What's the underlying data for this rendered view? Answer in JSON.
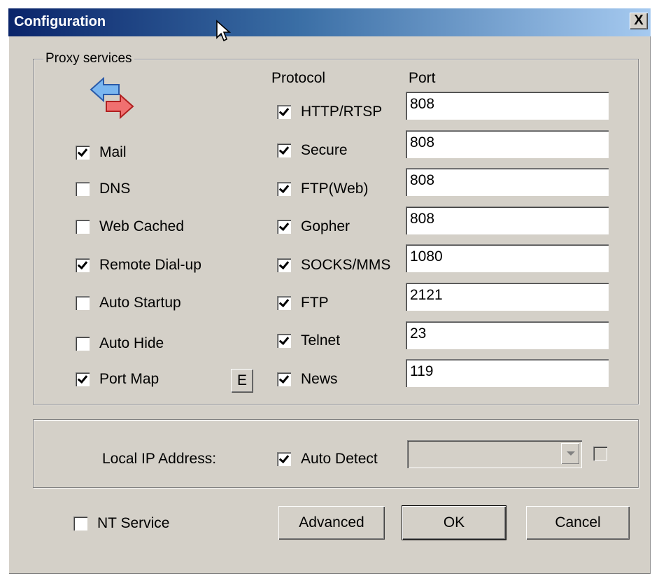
{
  "window": {
    "title": "Configuration",
    "close_label": "X"
  },
  "proxy": {
    "group_label": "Proxy services",
    "services": [
      {
        "label": "Mail",
        "checked": true
      },
      {
        "label": "DNS",
        "checked": false
      },
      {
        "label": "Web Cached",
        "checked": false
      },
      {
        "label": "Remote Dial-up",
        "checked": true
      },
      {
        "label": "Auto Startup",
        "checked": false
      },
      {
        "label": "Auto Hide",
        "checked": false
      },
      {
        "label": "Port Map",
        "checked": true
      }
    ],
    "portmap_edit_label": "E",
    "protocol_header": "Protocol",
    "port_header": "Port",
    "protocols": [
      {
        "label": "HTTP/RTSP",
        "checked": true,
        "port": "808"
      },
      {
        "label": "Secure",
        "checked": true,
        "port": "808"
      },
      {
        "label": "FTP(Web)",
        "checked": true,
        "port": "808"
      },
      {
        "label": "Gopher",
        "checked": true,
        "port": "808"
      },
      {
        "label": "SOCKS/MMS",
        "checked": true,
        "port": "1080"
      },
      {
        "label": "FTP",
        "checked": true,
        "port": "2121"
      },
      {
        "label": "Telnet",
        "checked": true,
        "port": "23"
      },
      {
        "label": "News",
        "checked": true,
        "port": "119"
      }
    ]
  },
  "local_ip": {
    "label": "Local IP Address:",
    "auto_detect_label": "Auto Detect",
    "auto_detect_checked": true,
    "address_value": "",
    "extra_checked": false
  },
  "footer": {
    "nt_service_label": "NT Service",
    "nt_service_checked": false,
    "advanced_label": "Advanced",
    "ok_label": "OK",
    "cancel_label": "Cancel"
  },
  "colors": {
    "face": "#d4d0c8",
    "title_start": "#0a246a",
    "title_end": "#a6caf0"
  }
}
